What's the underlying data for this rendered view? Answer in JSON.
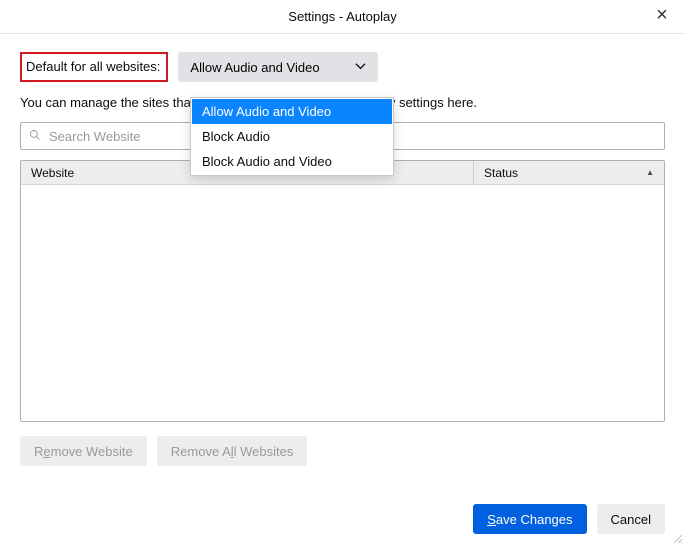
{
  "window": {
    "title": "Settings - Autoplay"
  },
  "default_row": {
    "label": "Default for all websites:",
    "selected": "Allow Audio and Video",
    "options": [
      "Allow Audio and Video",
      "Block Audio",
      "Block Audio and Video"
    ]
  },
  "hint": "You can manage the sites that do not follow your default autoplay settings here.",
  "search": {
    "placeholder": "Search Website"
  },
  "table": {
    "col_website": "Website",
    "col_status": "Status"
  },
  "buttons": {
    "remove_pre": "R",
    "remove_u": "e",
    "remove_post": "move Website",
    "removeall_pre": "Remove A",
    "removeall_u": "l",
    "removeall_post": "l Websites",
    "save_u": "S",
    "save_post": "ave Changes",
    "cancel": "Cancel"
  }
}
